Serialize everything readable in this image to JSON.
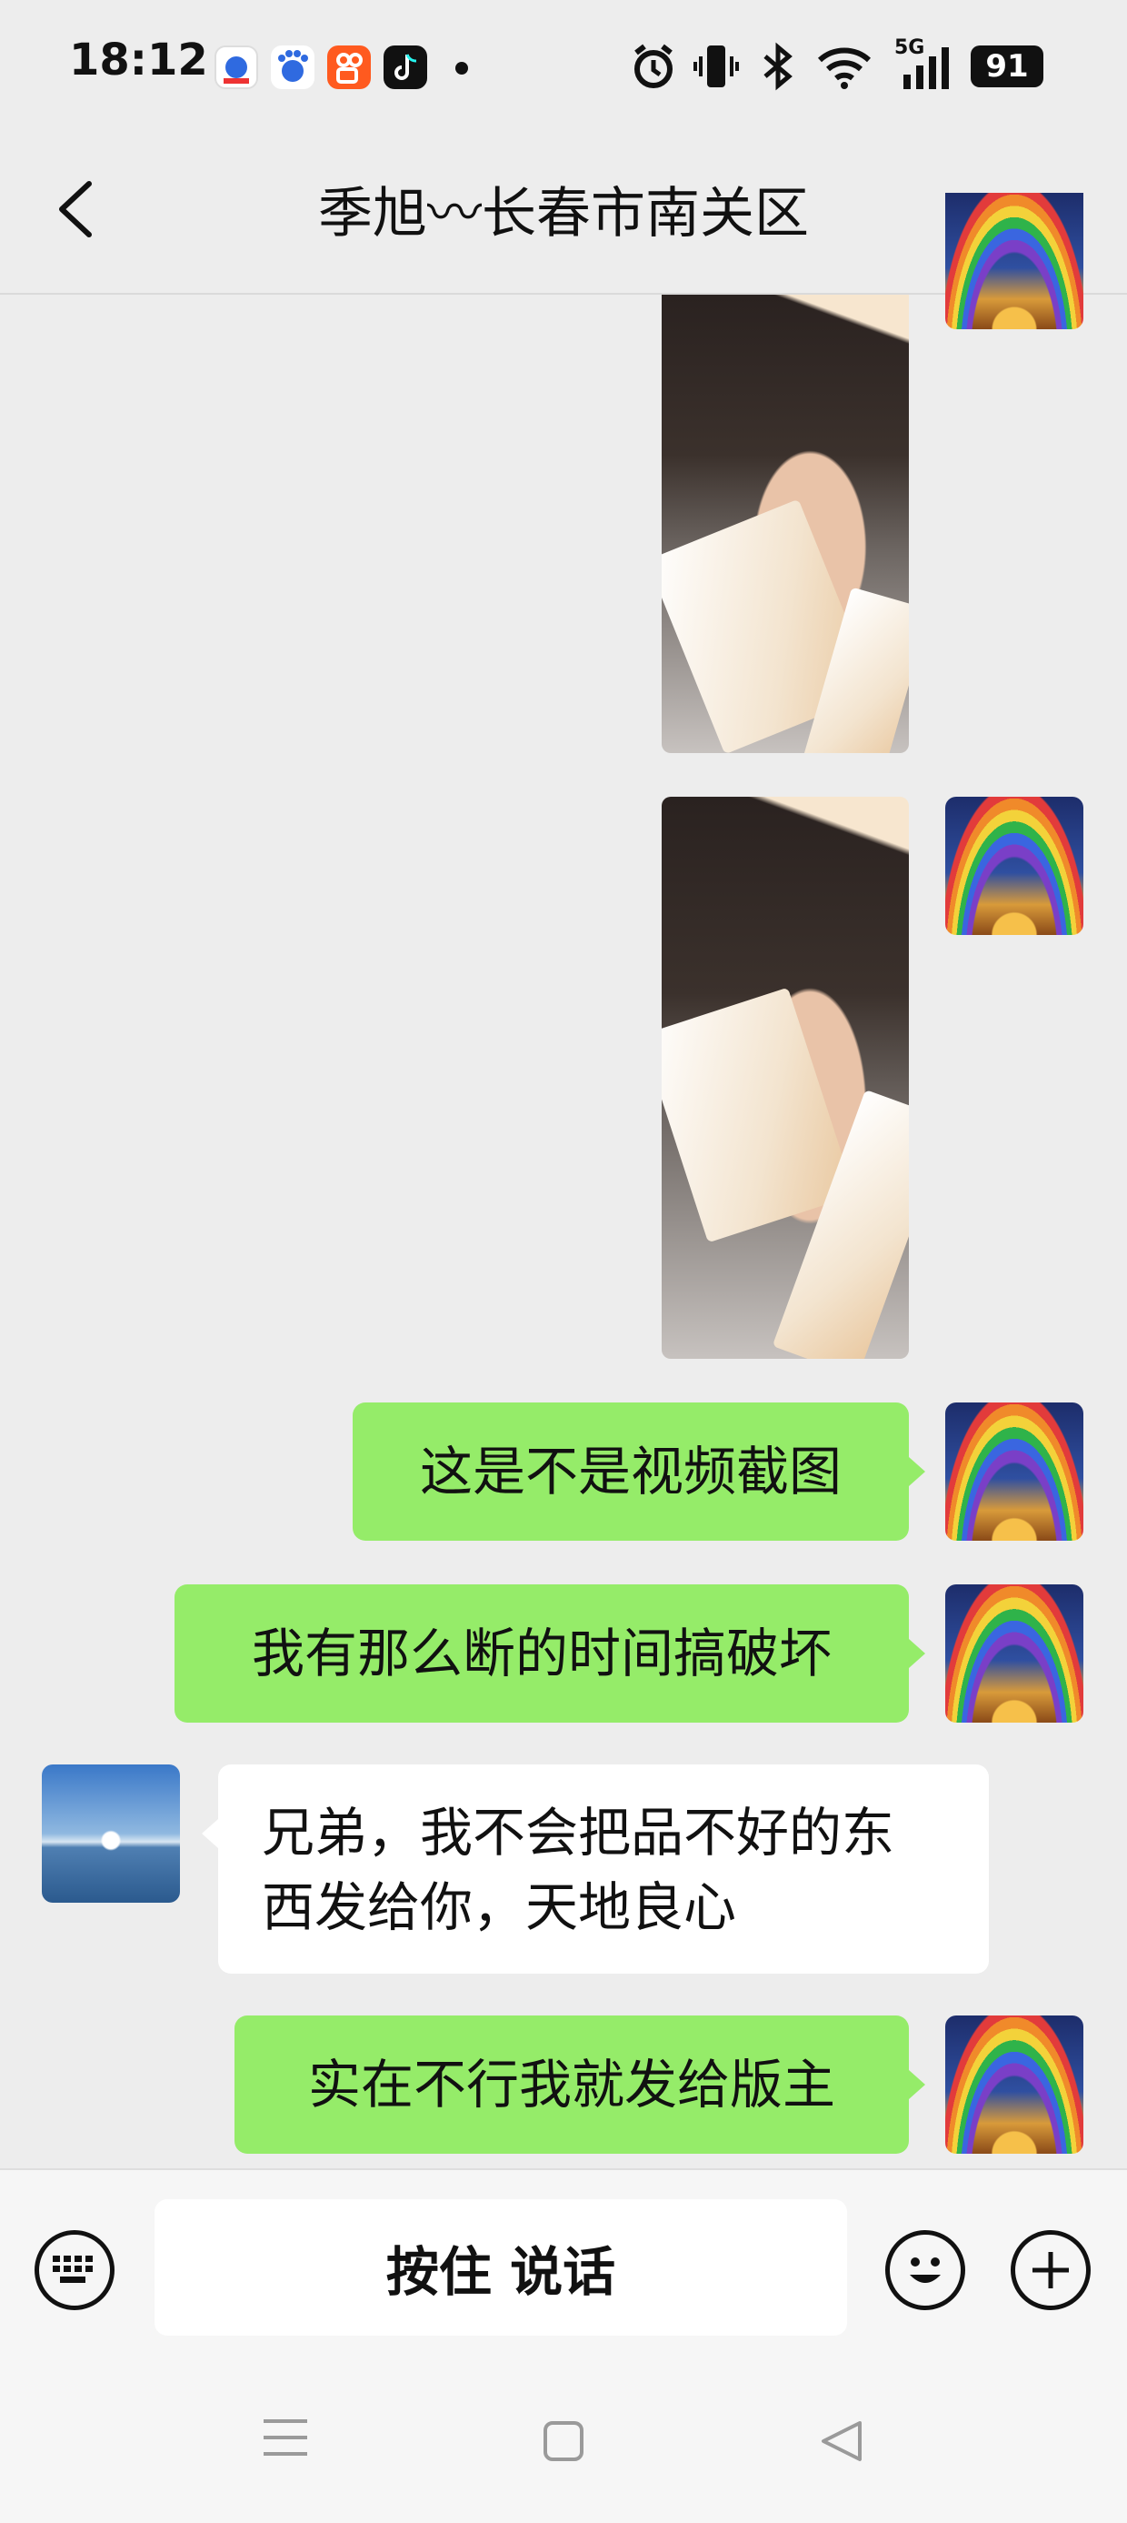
{
  "status_bar": {
    "time": "18:12",
    "network": "5G",
    "battery": "91",
    "icons": [
      "baidu-app-icon",
      "baidu-icon",
      "kuaishou-icon",
      "douyin-icon",
      "alarm-icon",
      "vibrate-icon",
      "bluetooth-icon",
      "wifi-icon",
      "signal-icon"
    ]
  },
  "header": {
    "title": "季旭〰长春市南关区",
    "back_icon": "chevron-left-icon",
    "more_icon": "more-dots-icon"
  },
  "messages": [
    {
      "type": "image",
      "side": "right",
      "description_icon": "photo-thumbnail"
    },
    {
      "type": "image",
      "side": "right",
      "description_icon": "photo-thumbnail"
    },
    {
      "type": "text",
      "side": "right",
      "text": "这是不是视频截图"
    },
    {
      "type": "text",
      "side": "right",
      "text": "我有那么断的时间搞破坏"
    },
    {
      "type": "text",
      "side": "left",
      "lines": [
        "兄弟，我不会把品不好的东",
        "西发给你，天地良心"
      ]
    },
    {
      "type": "text",
      "side": "right",
      "text": "实在不行我就发给版主"
    }
  ],
  "input_bar": {
    "hold_to_talk": "按住 说话",
    "keyboard_icon": "keyboard-icon",
    "emoji_icon": "emoji-icon",
    "plus_icon": "plus-icon"
  },
  "colors": {
    "green_bubble": "#95EC69",
    "white_bubble": "#FFFFFF",
    "background": "#EDEDED"
  }
}
